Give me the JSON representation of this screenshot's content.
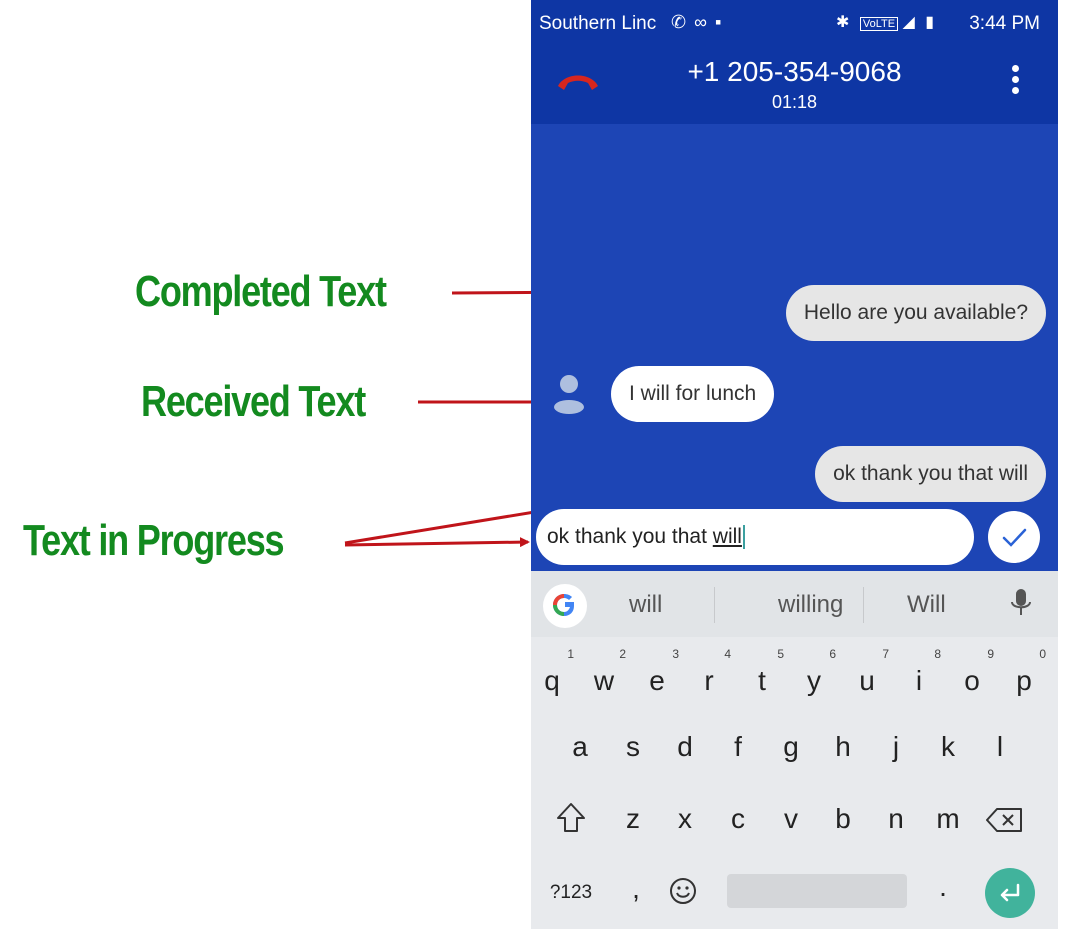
{
  "annotations": {
    "completed": "Completed Text",
    "received": "Received Text",
    "in_progress": "Text in Progress"
  },
  "status_bar": {
    "carrier": "Southern Linc",
    "time": "3:44 PM",
    "icons": [
      "wifi-call-icon",
      "voicemail-icon",
      "image-icon",
      "bluetooth-icon",
      "volte-icon",
      "signal-icon",
      "battery-icon"
    ]
  },
  "call": {
    "number": "+1 205-354-9068",
    "duration": "01:18"
  },
  "messages": [
    {
      "text": "Hello are you available?",
      "type": "sent"
    },
    {
      "text": "I will  for lunch",
      "type": "received"
    },
    {
      "text": "ok thank you that will",
      "type": "sent"
    }
  ],
  "input": {
    "prefix": "ok thank you that ",
    "current_word": "will"
  },
  "suggestions": [
    "will",
    "willing",
    "Will"
  ],
  "keyboard": {
    "row1": [
      "q",
      "w",
      "e",
      "r",
      "t",
      "y",
      "u",
      "i",
      "o",
      "p"
    ],
    "row1_hints": [
      "1",
      "2",
      "3",
      "4",
      "5",
      "6",
      "7",
      "8",
      "9",
      "0"
    ],
    "row2": [
      "a",
      "s",
      "d",
      "f",
      "g",
      "h",
      "j",
      "k",
      "l"
    ],
    "row3": [
      "z",
      "x",
      "c",
      "v",
      "b",
      "n",
      "m"
    ],
    "symbols_label": "?123",
    "comma": ",",
    "period": "."
  },
  "colors": {
    "annotation": "#138a1f",
    "arrow": "#c0141a",
    "call_bg": "#1d45b5",
    "header_bg": "#0e36a4",
    "enter": "#41b39c"
  }
}
